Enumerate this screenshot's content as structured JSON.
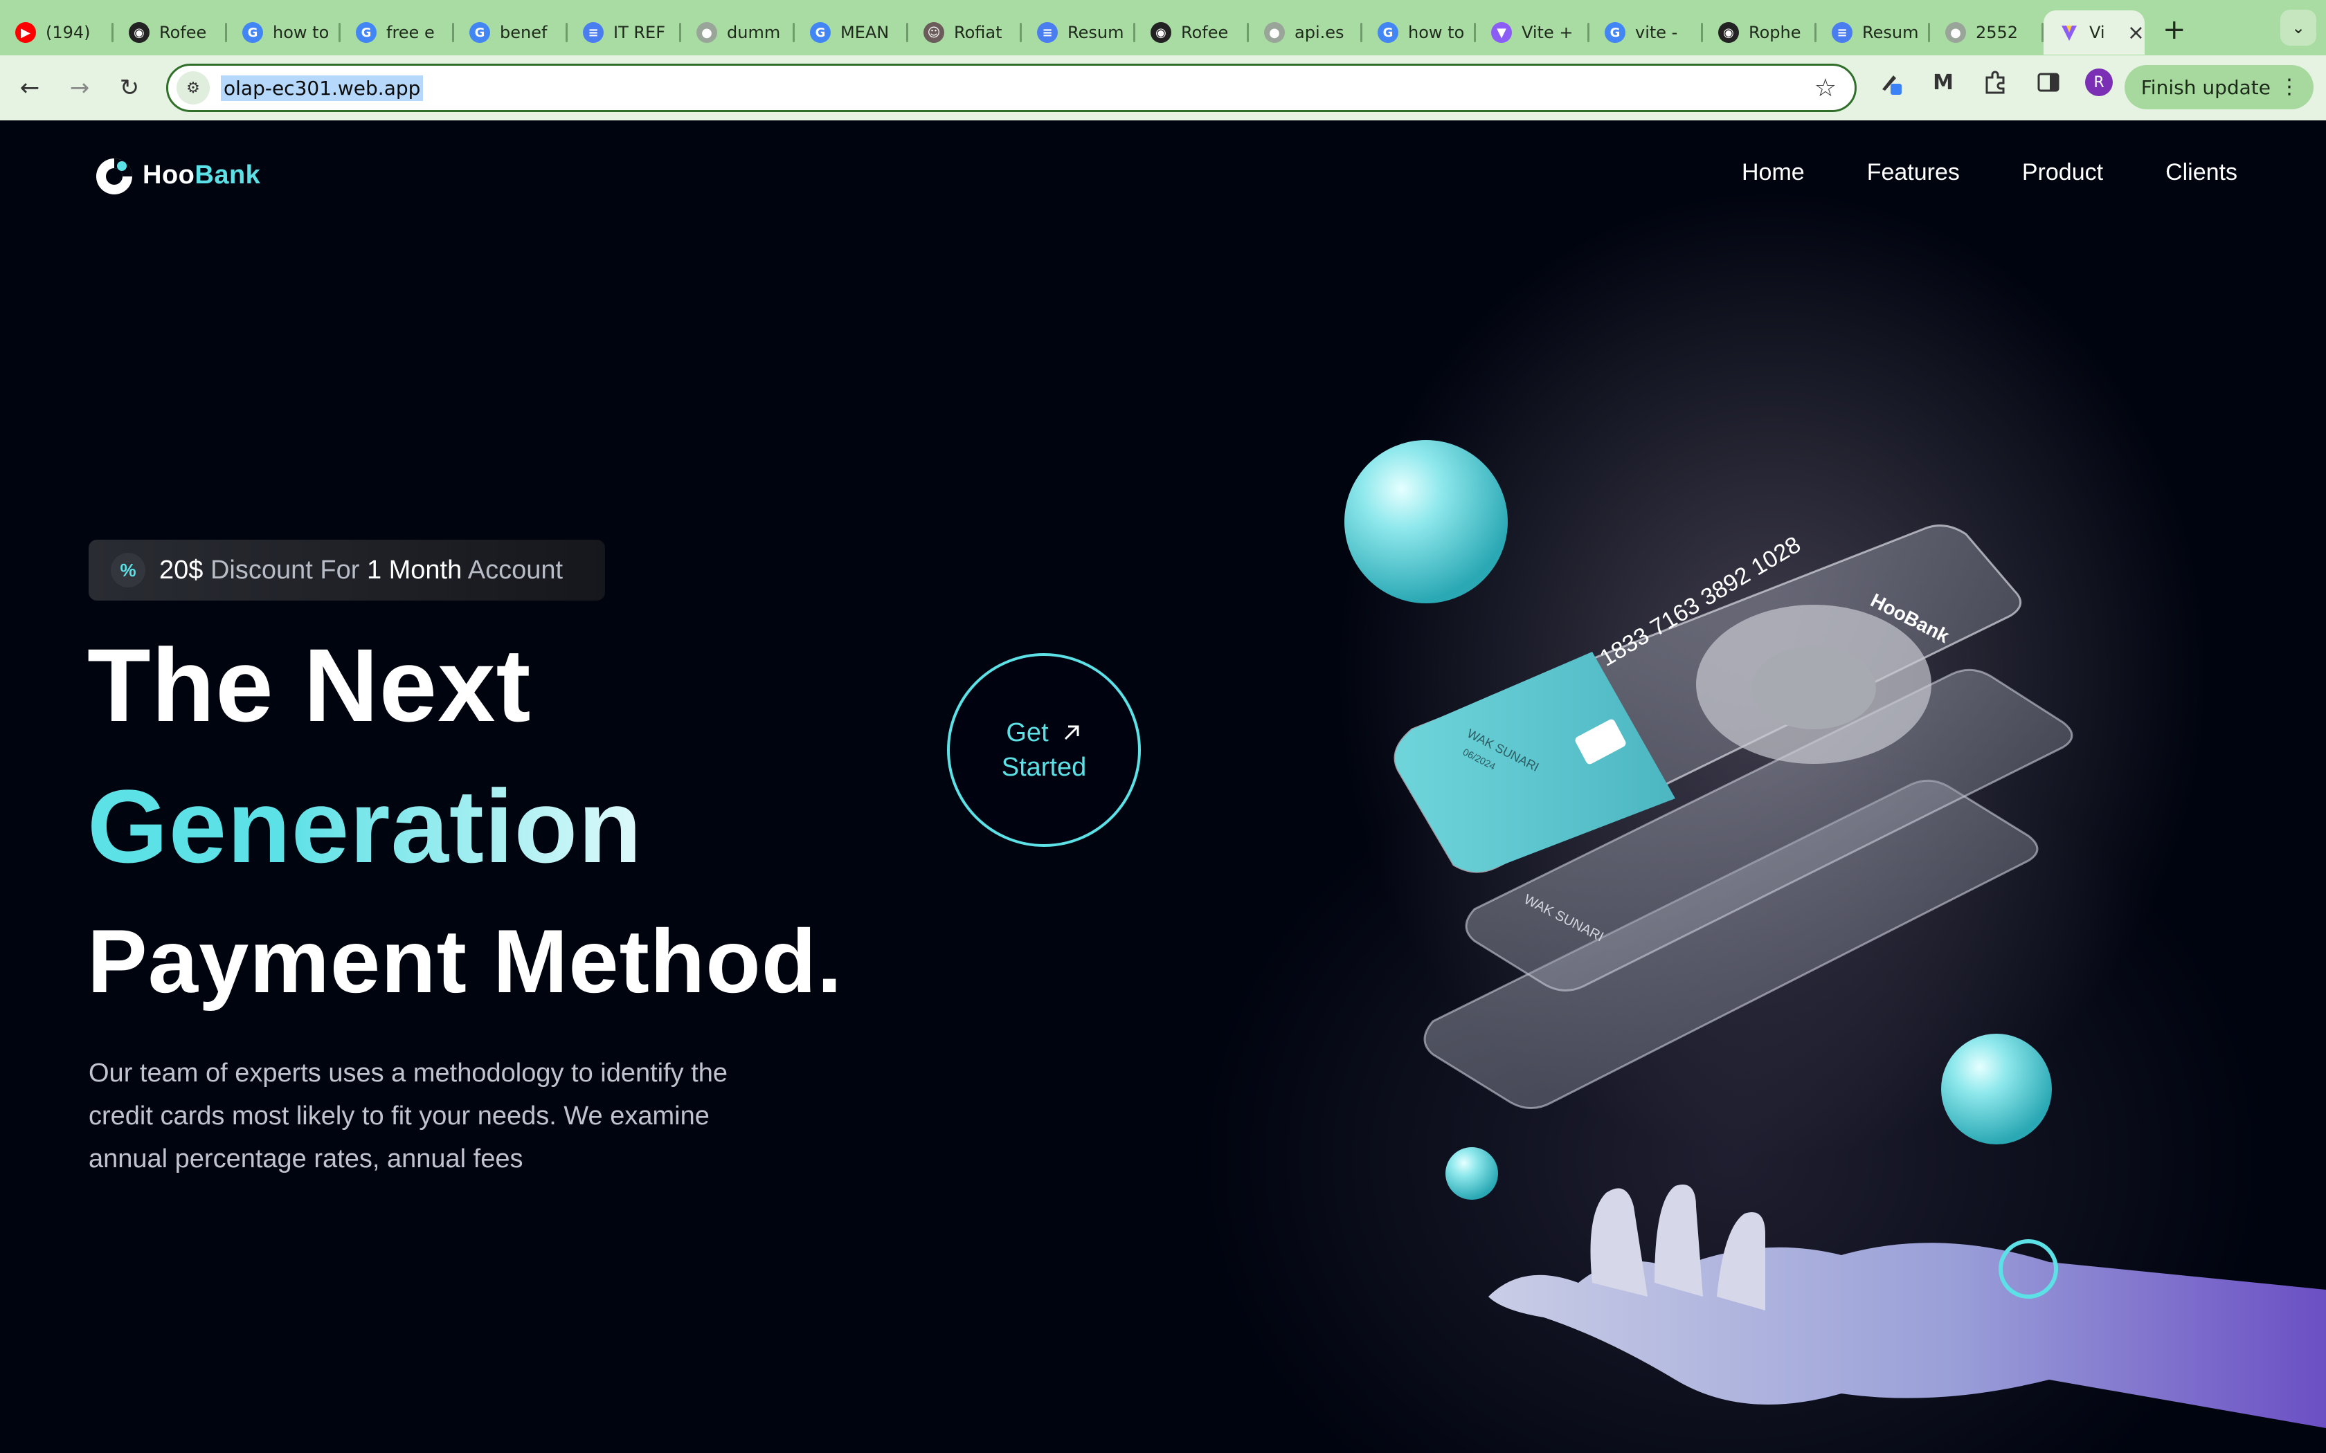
{
  "browser": {
    "tabs": [
      {
        "title": "(194)",
        "icon": "youtube-icon",
        "color": "#ff0000"
      },
      {
        "title": "Rofee",
        "icon": "github-icon",
        "color": "#222222"
      },
      {
        "title": "how to",
        "icon": "google-icon",
        "color": "#4285f4"
      },
      {
        "title": "free e",
        "icon": "google-icon",
        "color": "#4285f4"
      },
      {
        "title": "benef",
        "icon": "google-icon",
        "color": "#4285f4"
      },
      {
        "title": "IT REF",
        "icon": "docs-icon",
        "color": "#4a7df0"
      },
      {
        "title": "dumm",
        "icon": "globe-icon",
        "color": "#9aa59a"
      },
      {
        "title": "MEAN",
        "icon": "google-icon",
        "color": "#4285f4"
      },
      {
        "title": "Rofiat",
        "icon": "profile-icon",
        "color": "#6b5b5b"
      },
      {
        "title": "Resum",
        "icon": "docs-icon",
        "color": "#4a7df0"
      },
      {
        "title": "Rofee",
        "icon": "github-icon",
        "color": "#222222"
      },
      {
        "title": "api.es",
        "icon": "globe-icon",
        "color": "#9aa59a"
      },
      {
        "title": "how to",
        "icon": "google-icon",
        "color": "#4285f4"
      },
      {
        "title": "Vite +",
        "icon": "vite-icon",
        "color": "#8c5cf6"
      },
      {
        "title": "vite -",
        "icon": "google-icon",
        "color": "#4285f4"
      },
      {
        "title": "Rophe",
        "icon": "github-icon",
        "color": "#222222"
      },
      {
        "title": "Resum",
        "icon": "docs-icon",
        "color": "#4a7df0"
      },
      {
        "title": "2552",
        "icon": "globe-icon",
        "color": "#9aa59a"
      }
    ],
    "active_tab": {
      "title": "Vi",
      "icon": "vite-icon",
      "color": "#8c5cf6"
    },
    "url": "olap-ec301.web.app",
    "finish_update_label": "Finish update",
    "profile_initial": "R"
  },
  "site": {
    "logo": {
      "part1": "Hoo",
      "part2": "Bank"
    },
    "nav": [
      "Home",
      "Features",
      "Product",
      "Clients"
    ],
    "badge": {
      "amount": "20$",
      "t1": "Discount For",
      "months": "1 Month",
      "t2": "Account"
    },
    "headline": {
      "line1": "The Next",
      "line2": "Generation",
      "line3": "Payment Method."
    },
    "paragraph": "Our team of experts uses a methodology to identify the credit cards most likely to fit your needs. We examine annual percentage rates, annual fees",
    "cta": {
      "line1": "Get",
      "line2": "Started"
    },
    "card": {
      "number": "1833 7163 3892 1028",
      "holder": "WAK SUNARI",
      "expiry": "06/2024",
      "brand": "HooBank"
    }
  },
  "colors": {
    "accent": "#5ce1e6",
    "background": "#00040f",
    "tab_strip": "#a9dca2",
    "toolbar": "#e6f3e2"
  }
}
